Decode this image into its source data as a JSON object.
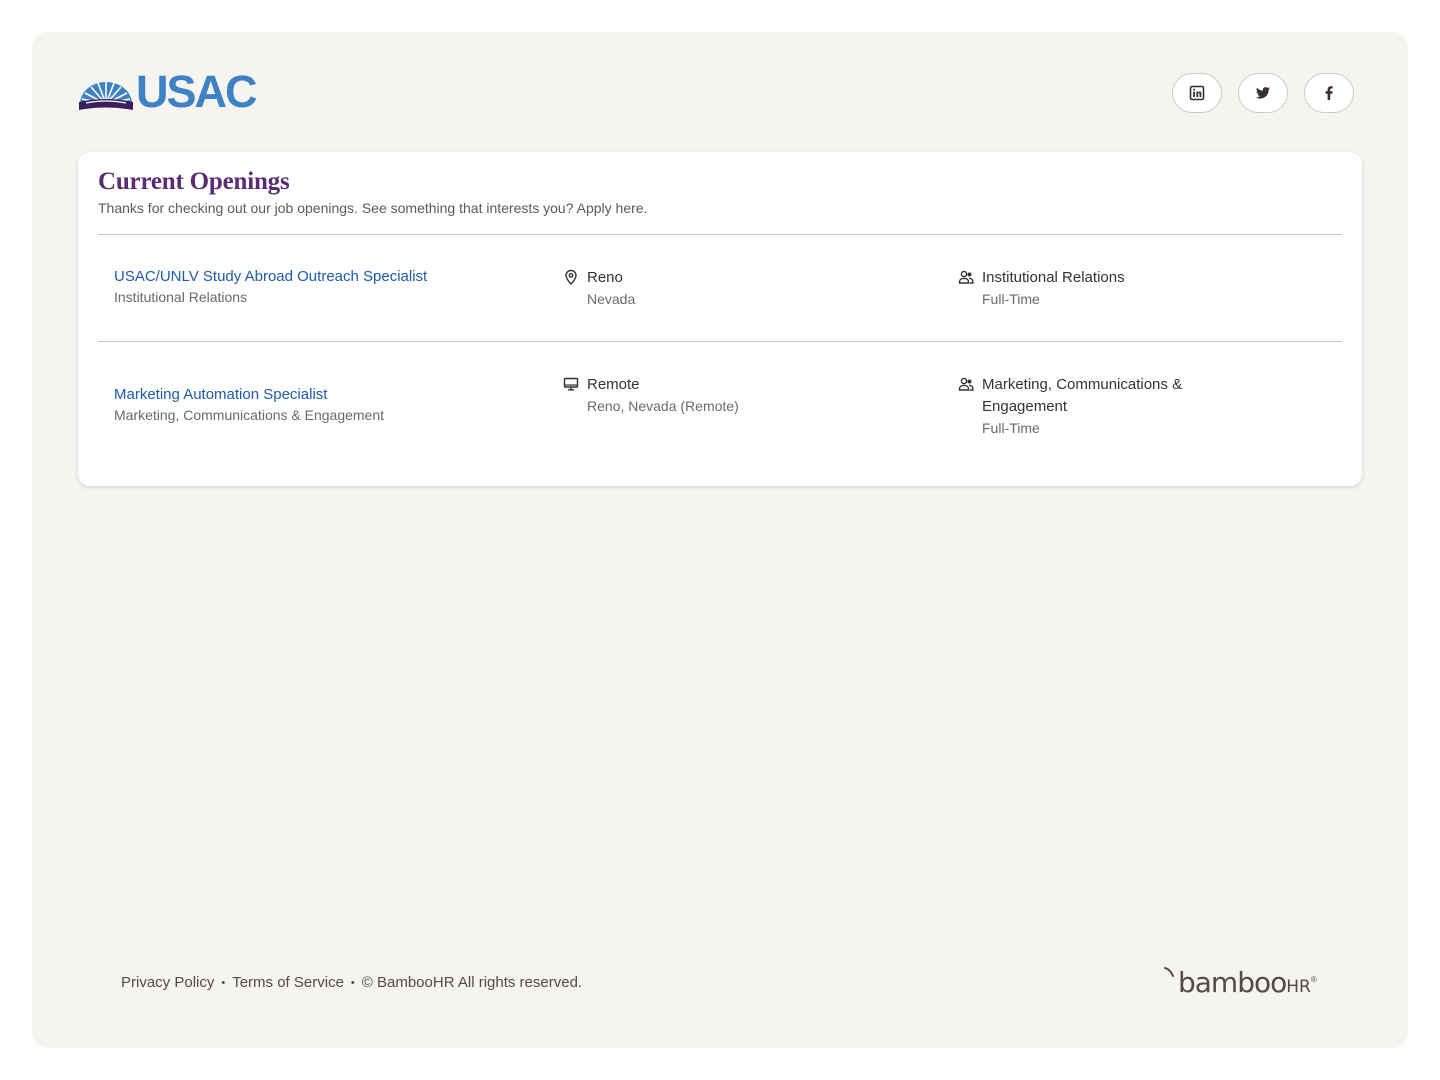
{
  "brand": {
    "logo_text": "USAC",
    "logo_color": "#3f82c4",
    "logo_mark_colors": [
      "#3f82c4",
      "#3a1f5c",
      "#ffffff"
    ]
  },
  "socials": [
    {
      "name": "linkedin",
      "icon": "linkedin-icon"
    },
    {
      "name": "twitter",
      "icon": "twitter-icon"
    },
    {
      "name": "facebook",
      "icon": "facebook-icon"
    }
  ],
  "openings": {
    "title": "Current Openings",
    "subtitle": "Thanks for checking out our job openings. See something that interests you? Apply here.",
    "jobs": [
      {
        "title": "USAC/UNLV Study Abroad Outreach Specialist",
        "department": "Institutional Relations",
        "location_icon": "map-pin-icon",
        "location_primary": "Reno",
        "location_secondary": "Nevada",
        "team_icon": "people-icon",
        "team_line1": "Institutional Relations",
        "team_line2": "",
        "employment_type": "Full-Time"
      },
      {
        "title": "Marketing Automation Specialist",
        "department": "Marketing, Communications & Engagement",
        "location_icon": "monitor-icon",
        "location_primary": "Remote",
        "location_secondary": "Reno, Nevada (Remote)",
        "team_icon": "people-icon",
        "team_line1": "Marketing, Communications &",
        "team_line2": "Engagement",
        "employment_type": "Full-Time"
      }
    ]
  },
  "footer": {
    "privacy": "Privacy Policy",
    "terms": "Terms of Service",
    "copyright": "© BambooHR All rights reserved.",
    "separator": "•",
    "powered_by_word": "bamboo",
    "powered_by_suffix": "HR",
    "powered_by_mark": "®"
  },
  "colors": {
    "page_bg": "#f5f4f1",
    "title": "#5b2c6f",
    "link": "#1e5ba8",
    "text": "#38312f",
    "muted": "#6f6864"
  }
}
